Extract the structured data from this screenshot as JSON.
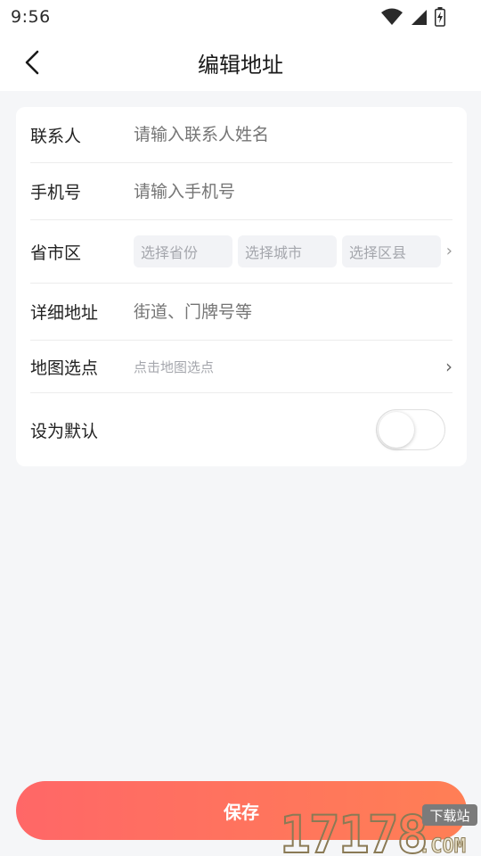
{
  "status_bar": {
    "time": "9:56",
    "icons": [
      "wifi-icon",
      "signal-icon",
      "battery-charging-icon"
    ]
  },
  "nav": {
    "title": "编辑地址",
    "back_icon": "chevron-left-icon"
  },
  "form": {
    "contact": {
      "label": "联系人",
      "placeholder": "请输入联系人姓名"
    },
    "phone": {
      "label": "手机号",
      "placeholder": "请输入手机号"
    },
    "region": {
      "label": "省市区",
      "province": "选择省份",
      "city": "选择城市",
      "district": "选择区县",
      "chevron": "›"
    },
    "detail": {
      "label": "详细地址",
      "placeholder": "街道、门牌号等"
    },
    "map": {
      "label": "地图选点",
      "placeholder": "点击地图选点",
      "chevron": "›"
    },
    "default": {
      "label": "设为默认",
      "enabled": false
    }
  },
  "save_button": {
    "label": "保存"
  },
  "watermark": {
    "brand": "17178",
    "domain": ".COM",
    "tag": "下载站"
  },
  "colors": {
    "accent_start": "#ff6767",
    "accent_end": "#ff7f55",
    "placeholder": "#a5a7ad",
    "background": "#f5f6f8"
  }
}
